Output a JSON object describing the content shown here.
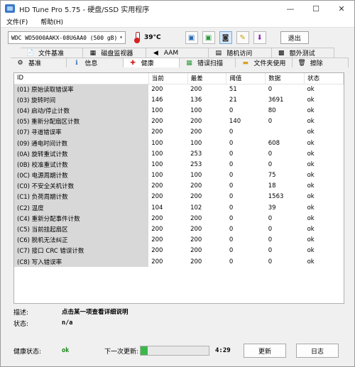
{
  "title": "HD Tune Pro 5.75 - 硬盘/SSD 实用程序",
  "window_controls": {
    "minimize": "—",
    "maximize": "☐",
    "close": "✕"
  },
  "menu": [
    "文件(F)",
    "帮助(H)"
  ],
  "drive": {
    "selected": "WDC WD5000AAKX-08U6AA0 (500 gB)"
  },
  "temperature": "39°C",
  "exit_label": "退出",
  "tabs_row1": [
    {
      "label": "文件基准",
      "icon": "file-benchmark-icon"
    },
    {
      "label": "磁盘监视器",
      "icon": "disk-monitor-icon"
    },
    {
      "label": "AAM",
      "icon": "speaker-icon"
    },
    {
      "label": "随机访问",
      "icon": "random-access-icon"
    },
    {
      "label": "额外测试",
      "icon": "extra-tests-icon"
    }
  ],
  "tabs_row2": [
    {
      "label": "基准",
      "icon": "benchmark-icon"
    },
    {
      "label": "信息",
      "icon": "info-icon"
    },
    {
      "label": "健康",
      "icon": "health-cross-icon"
    },
    {
      "label": "错误扫描",
      "icon": "error-scan-icon"
    },
    {
      "label": "文件夹使用",
      "icon": "folder-icon"
    },
    {
      "label": "擦除",
      "icon": "erase-icon"
    }
  ],
  "active_tab": "健康",
  "table": {
    "headers": [
      "ID",
      "当前",
      "最差",
      "阈值",
      "数据",
      "状态"
    ],
    "rows": [
      [
        "(01) 原始读取错误率",
        "200",
        "200",
        "51",
        "0",
        "ok"
      ],
      [
        "(03) 旋转时间",
        "146",
        "136",
        "21",
        "3691",
        "ok"
      ],
      [
        "(04) 启动/停止计数",
        "100",
        "100",
        "0",
        "80",
        "ok"
      ],
      [
        "(05) 重新分配扇区计数",
        "200",
        "200",
        "140",
        "0",
        "ok"
      ],
      [
        "(07) 寻道错误率",
        "200",
        "200",
        "0",
        "",
        "ok"
      ],
      [
        "(09) 通电时间计数",
        "100",
        "100",
        "0",
        "608",
        "ok"
      ],
      [
        "(0A) 旋转重试计数",
        "100",
        "253",
        "0",
        "0",
        "ok"
      ],
      [
        "(0B) 校准重试计数",
        "100",
        "253",
        "0",
        "0",
        "ok"
      ],
      [
        "(0C) 电源周期计数",
        "100",
        "100",
        "0",
        "75",
        "ok"
      ],
      [
        "(C0) 不安全关机计数",
        "200",
        "200",
        "0",
        "18",
        "ok"
      ],
      [
        "(C1) 负荷周期计数",
        "200",
        "200",
        "0",
        "1563",
        "ok"
      ],
      [
        "(C2) 温度",
        "104",
        "102",
        "0",
        "39",
        "ok"
      ],
      [
        "(C4) 重新分配事件计数",
        "200",
        "200",
        "0",
        "0",
        "ok"
      ],
      [
        "(C5) 当前挂起扇区",
        "200",
        "200",
        "0",
        "0",
        "ok"
      ],
      [
        "(C6) 脱机无法纠正",
        "200",
        "200",
        "0",
        "0",
        "ok"
      ],
      [
        "(C7) 接口 CRC 错误计数",
        "200",
        "200",
        "0",
        "0",
        "ok"
      ],
      [
        "(C8) 写入错误率",
        "200",
        "200",
        "0",
        "0",
        "ok"
      ]
    ]
  },
  "description": {
    "label": "描述:",
    "value": "点击某一项查看详细说明"
  },
  "status": {
    "label": "状态:",
    "value": "n/a"
  },
  "health": {
    "label": "健康状态:",
    "value": "ok"
  },
  "next_update": {
    "label": "下一次更新:",
    "countdown": "4:29",
    "progress": 0.1
  },
  "refresh_label": "更新",
  "log_label": "日志"
}
